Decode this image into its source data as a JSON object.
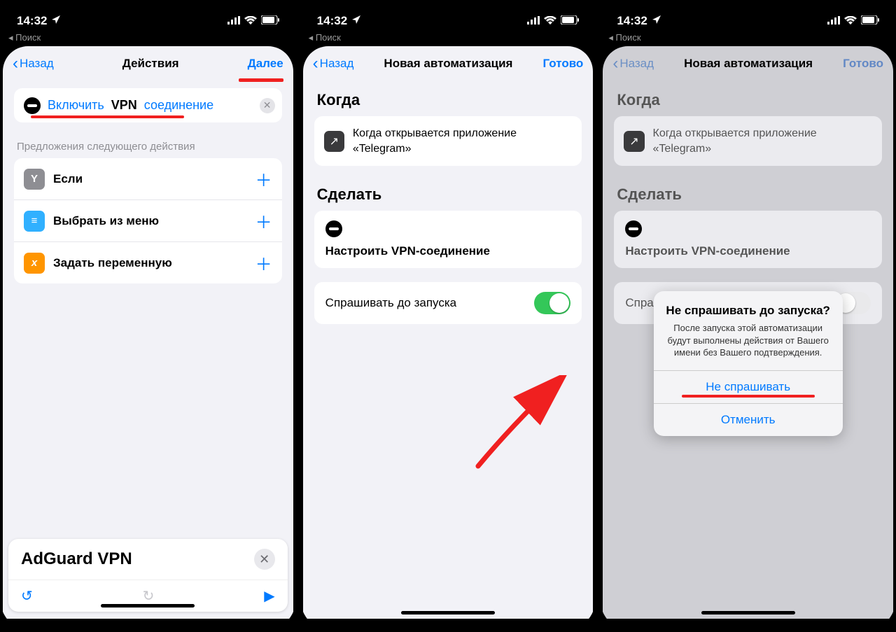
{
  "status": {
    "time": "14:32",
    "search": "Поиск"
  },
  "screen1": {
    "back": "Назад",
    "title": "Действия",
    "next": "Далее",
    "action": {
      "t1": "Включить",
      "t2": "VPN",
      "t3": "соединение"
    },
    "suggest_label": "Предложения следующего действия",
    "rows": [
      {
        "label": "Если",
        "bg": "#8e8e93",
        "glyph": "Y"
      },
      {
        "label": "Выбрать из меню",
        "bg": "#30b0ff",
        "glyph": "≡"
      },
      {
        "label": "Задать переменную",
        "bg": "#ff9500",
        "glyph": "x"
      }
    ],
    "bottom": {
      "title": "AdGuard VPN"
    }
  },
  "screen2": {
    "back": "Назад",
    "title": "Новая автоматизация",
    "done": "Готово",
    "when_h": "Когда",
    "when_text": "Когда открывается приложение «Telegram»",
    "do_h": "Сделать",
    "do_text": "Настроить VPN-соединение",
    "ask_label": "Спрашивать до запуска"
  },
  "screen3": {
    "back": "Назад",
    "title": "Новая автоматизация",
    "done": "Готово",
    "when_h": "Когда",
    "when_text": "Когда открывается приложение «Telegram»",
    "do_h": "Сделать",
    "do_text": "Настроить VPN-соединение",
    "ask_label": "Спрашивать до запуска",
    "modal": {
      "title": "Не спрашивать до запуска?",
      "text": "После запуска этой автоматизации будут выполнены действия от Вашего имени без Вашего подтверждения.",
      "primary": "Не спрашивать",
      "cancel": "Отменить"
    }
  }
}
